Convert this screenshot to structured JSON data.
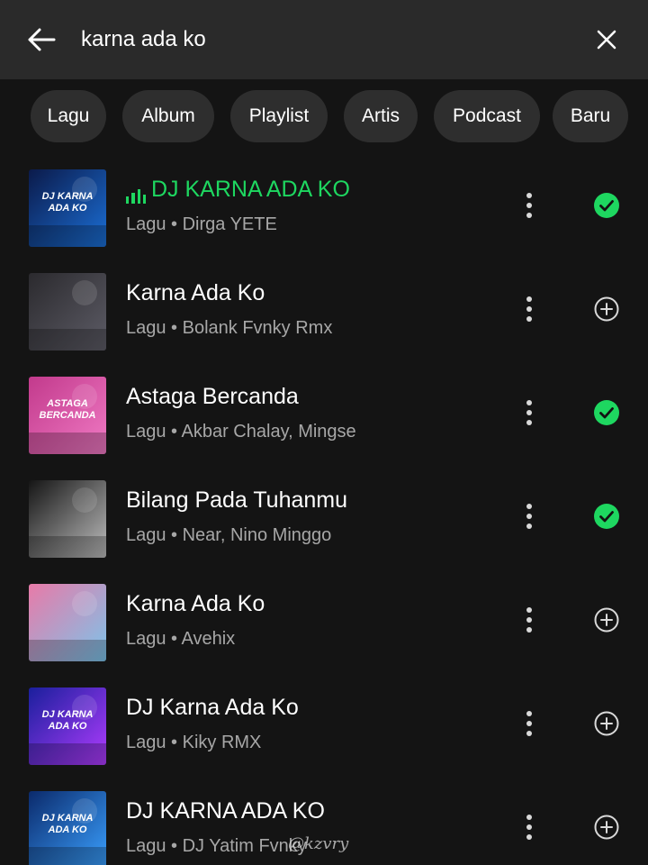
{
  "search": {
    "query": "karna ada ko"
  },
  "filters": [
    "Lagu",
    "Album",
    "Playlist",
    "Artis",
    "Podcast",
    "Baru"
  ],
  "results": [
    {
      "title": "DJ KARNA ADA KO",
      "subtitle": "Lagu • Dirga YETE",
      "playing": true,
      "status": "added",
      "cover_text": "DJ KARNA ADA KO",
      "cover_colors": [
        "#0b1a4a",
        "#1b6fd6"
      ]
    },
    {
      "title": "Karna Ada Ko",
      "subtitle": "Lagu • Bolank Fvnky Rmx",
      "playing": false,
      "status": "add",
      "cover_text": "",
      "cover_colors": [
        "#2b2a2e",
        "#5d5c66"
      ]
    },
    {
      "title": "Astaga Bercanda",
      "subtitle": "Lagu • Akbar Chalay, Mingse",
      "playing": false,
      "status": "added",
      "cover_text": "ASTAGA BERCANDA",
      "cover_colors": [
        "#c23a8c",
        "#f07ac4"
      ]
    },
    {
      "title": "Bilang Pada Tuhanmu",
      "subtitle": "Lagu • Near, Nino Minggo",
      "playing": false,
      "status": "added",
      "cover_text": "",
      "cover_colors": [
        "#151515",
        "#bdbdbd"
      ]
    },
    {
      "title": "Karna Ada Ko",
      "subtitle": "Lagu • Avehix",
      "playing": false,
      "status": "add",
      "cover_text": "",
      "cover_colors": [
        "#e87aa8",
        "#7cc4ea"
      ]
    },
    {
      "title": "DJ Karna Ada Ko",
      "subtitle": "Lagu • Kiky RMX",
      "playing": false,
      "status": "add",
      "cover_text": "DJ KARNA ADA KO",
      "cover_colors": [
        "#1a1f9c",
        "#b03cff"
      ]
    },
    {
      "title": "DJ KARNA ADA KO",
      "subtitle": "Lagu • DJ Yatim Fvnky",
      "playing": false,
      "status": "add",
      "cover_text": "DJ KARNA ADA KO",
      "cover_colors": [
        "#0b2a6b",
        "#3aa0ff"
      ]
    }
  ],
  "watermark": "@kzvry",
  "colors": {
    "accent": "#1ed760",
    "background": "#141414",
    "header": "#2a2a2a",
    "chip": "#2e2e2e",
    "secondary_text": "#a7a7a7"
  }
}
